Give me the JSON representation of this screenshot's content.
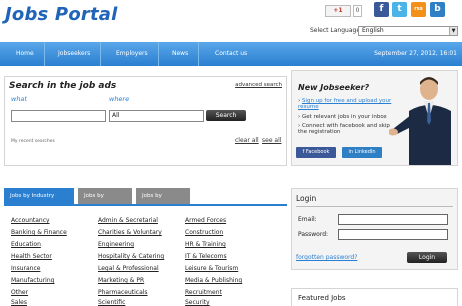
{
  "header": {
    "logo": "Jobs Portal",
    "gplus_label": "+1",
    "gplus_count": "0",
    "social": {
      "facebook": "f",
      "twitter": "t",
      "rss": "rss",
      "blog": "b"
    },
    "language_label": "Select Language:",
    "language_value": "English"
  },
  "nav": {
    "items": [
      "Home",
      "Jobseekers",
      "Employers",
      "News",
      "Contact us"
    ],
    "date": "September 27, 2012, 16:01"
  },
  "search": {
    "title": "Search in the job ads",
    "advanced": "advanced search",
    "what_label": "what",
    "where_label": "where",
    "what_value": "",
    "where_value": "All",
    "button": "Search",
    "recent_label": "My recent searches",
    "clear_all": "clear all",
    "see_all": "see all"
  },
  "new_jobseeker": {
    "title": "New Jobseeker?",
    "bullet1_link": "Sign up for free and upload your resume",
    "bullet2": "Get relevant jobs in your inbox",
    "bullet3": "Connect with facebook and skip the registration",
    "facebook_button": "Facebook",
    "linkedin_button": "LinkedIn"
  },
  "tabs": {
    "industry": "Jobs by Industry Sector",
    "location": "Jobs by Location",
    "company": "Jobs by Company"
  },
  "sectors": {
    "col1": [
      "Accountancy",
      "Banking & Finance",
      "Education",
      "Health Sector",
      "Insurance",
      "Manufacturing",
      "Other",
      "Sales"
    ],
    "col2": [
      "Admin & Secretarial",
      "Charities & Voluntary",
      "Engineering",
      "Hospitality & Catering",
      "Legal & Professional",
      "Marketing & PR",
      "Pharmaceuticals",
      "Scientific"
    ],
    "col3": [
      "Armed Forces",
      "Construction",
      "HR & Training",
      "IT & Telecoms",
      "Leisure & Tourism",
      "Media & Publishing",
      "Recruitment",
      "Security"
    ]
  },
  "login": {
    "title": "Login",
    "email_label": "Email:",
    "password_label": "Password:",
    "forgot": "forgotten password?",
    "button": "Login"
  },
  "featured": {
    "title": "Featured Jobs"
  },
  "colors": {
    "brand_blue": "#2a7fd0",
    "logo_blue": "#1f64b8",
    "panel_bg": "#f4f4f4"
  }
}
